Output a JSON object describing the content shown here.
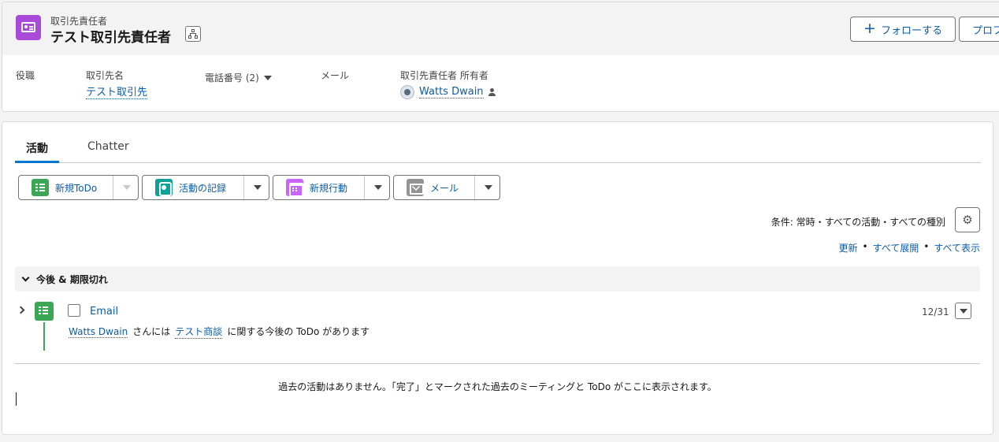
{
  "header": {
    "object_label": "取引先責任者",
    "record_title": "テスト取引先責任者",
    "follow_label": "フォローする",
    "profile_label": "プロフ"
  },
  "fields": {
    "title_label": "役職",
    "account_label": "取引先名",
    "account_value": "テスト取引先",
    "phone_label": "電話番号 (2)",
    "email_label": "メール",
    "owner_label": "取引先責任者 所有者",
    "owner_value": "Watts Dwain"
  },
  "tabs": {
    "activity": "活動",
    "chatter": "Chatter"
  },
  "actions": {
    "new_todo": "新規ToDo",
    "log_call": "活動の記録",
    "new_event": "新規行動",
    "email": "メール"
  },
  "filters": {
    "text": "条件: 常時・すべての活動・すべての種別",
    "refresh": "更新",
    "expand_all": "すべて展開",
    "view_all": "すべて表示",
    "separator": "•"
  },
  "upcoming": {
    "section_title": "今後 & 期限切れ",
    "task": {
      "title": "Email",
      "date": "12/31",
      "owner": "Watts Dwain",
      "text_mid": "さんには",
      "related": "テスト商談",
      "text_end": "に関する今後の ToDo があります"
    }
  },
  "past": {
    "empty_message": "過去の活動はありません。「完了」とマークされた過去のミーティングと ToDo がここに表示されます。"
  },
  "colors": {
    "contact_icon": "#a94bd8",
    "task_icon": "#3ba755",
    "call_icon": "#0aa196",
    "event_icon": "#cb65ff",
    "email_icon": "#939393",
    "link": "#0b5cab",
    "active_tab": "#0176d3"
  }
}
